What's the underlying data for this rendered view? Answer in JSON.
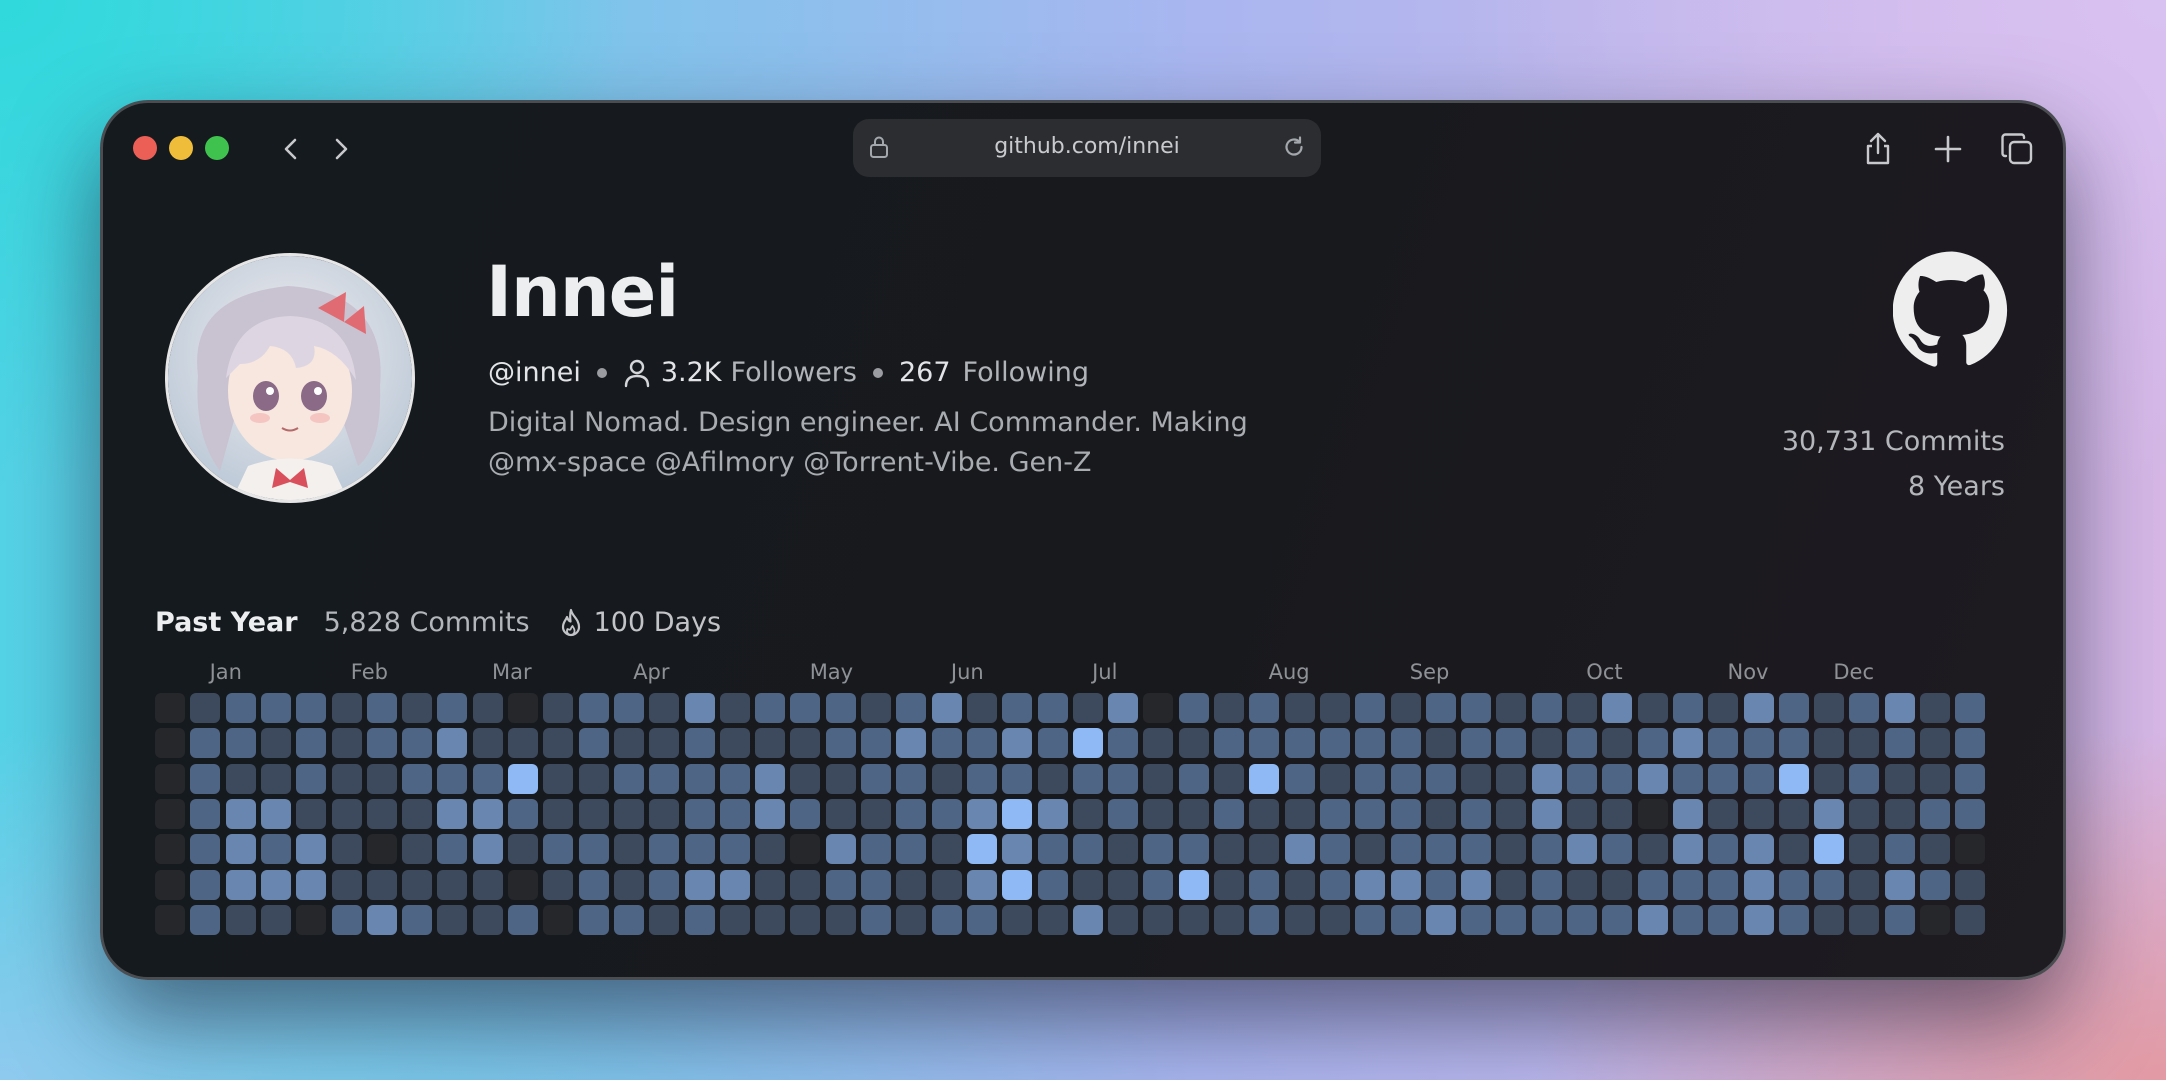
{
  "window": {
    "url": "github.com/innei",
    "traffic_lights": [
      "#ec5f57",
      "#f0bd3a",
      "#3fc34e"
    ],
    "icons": [
      "back-icon",
      "forward-icon",
      "lock-icon",
      "reload-icon",
      "share-icon",
      "plus-icon",
      "tabs-icon"
    ]
  },
  "profile": {
    "name": "Innei",
    "handle": "@innei",
    "followers_count": "3.2K",
    "followers_label": "Followers",
    "following_count": "267",
    "following_label": "Following",
    "bio_line1": "Digital Nomad. Design engineer. AI Commander. Making",
    "bio_line2": "@mx-space @Afilmory @Torrent-Vibe. Gen-Z",
    "total_commits": "30,731 Commits",
    "total_years": "8 Years"
  },
  "activity": {
    "title": "Past Year",
    "commits": "5,828 Commits",
    "streak": "100 Days",
    "months": [
      {
        "label": "Jan",
        "week": 2
      },
      {
        "label": "Feb",
        "week": 6
      },
      {
        "label": "Mar",
        "week": 10
      },
      {
        "label": "Apr",
        "week": 14
      },
      {
        "label": "May",
        "week": 19
      },
      {
        "label": "Jun",
        "week": 23
      },
      {
        "label": "Jul",
        "week": 27
      },
      {
        "label": "Aug",
        "week": 32
      },
      {
        "label": "Sep",
        "week": 36
      },
      {
        "label": "Oct",
        "week": 41
      },
      {
        "label": "Nov",
        "week": 45
      },
      {
        "label": "Dec",
        "week": 48
      }
    ],
    "level_colors": [
      "#25272b",
      "#3d4a5e",
      "#4e6585",
      "#6886b0",
      "#8fb9f4"
    ],
    "weeks": [
      [
        0,
        0,
        0,
        0,
        0,
        0,
        0
      ],
      [
        1,
        2,
        2,
        2,
        2,
        2,
        2
      ],
      [
        2,
        2,
        1,
        3,
        3,
        3,
        1
      ],
      [
        2,
        1,
        1,
        3,
        2,
        3,
        1
      ],
      [
        2,
        2,
        2,
        1,
        3,
        3,
        0
      ],
      [
        1,
        1,
        1,
        1,
        1,
        1,
        2
      ],
      [
        2,
        2,
        1,
        1,
        0,
        1,
        3
      ],
      [
        1,
        2,
        2,
        1,
        1,
        1,
        2
      ],
      [
        2,
        3,
        2,
        3,
        2,
        1,
        1
      ],
      [
        1,
        1,
        2,
        3,
        3,
        1,
        1
      ],
      [
        0,
        1,
        4,
        2,
        1,
        0,
        2
      ],
      [
        1,
        1,
        1,
        1,
        2,
        1,
        0
      ],
      [
        2,
        2,
        1,
        1,
        2,
        2,
        2
      ],
      [
        2,
        1,
        2,
        1,
        1,
        1,
        2
      ],
      [
        1,
        1,
        2,
        1,
        2,
        2,
        1
      ],
      [
        3,
        2,
        2,
        2,
        2,
        3,
        2
      ],
      [
        1,
        1,
        2,
        2,
        2,
        3,
        1
      ],
      [
        2,
        1,
        3,
        3,
        1,
        1,
        1
      ],
      [
        2,
        1,
        1,
        2,
        0,
        1,
        1
      ],
      [
        2,
        2,
        1,
        1,
        3,
        2,
        1
      ],
      [
        1,
        2,
        2,
        1,
        2,
        2,
        2
      ],
      [
        2,
        3,
        2,
        2,
        2,
        1,
        1
      ],
      [
        3,
        2,
        1,
        2,
        1,
        1,
        2
      ],
      [
        1,
        2,
        2,
        3,
        4,
        3,
        2
      ],
      [
        2,
        3,
        2,
        4,
        3,
        4,
        1
      ],
      [
        2,
        2,
        1,
        3,
        2,
        2,
        1
      ],
      [
        1,
        4,
        2,
        1,
        2,
        1,
        3
      ],
      [
        3,
        2,
        2,
        2,
        1,
        1,
        1
      ],
      [
        0,
        1,
        1,
        1,
        2,
        2,
        1
      ],
      [
        2,
        1,
        2,
        1,
        2,
        4,
        1
      ],
      [
        1,
        2,
        1,
        2,
        1,
        1,
        1
      ],
      [
        2,
        2,
        4,
        1,
        1,
        2,
        2
      ],
      [
        1,
        2,
        2,
        1,
        3,
        1,
        1
      ],
      [
        1,
        2,
        1,
        2,
        2,
        2,
        1
      ],
      [
        2,
        2,
        2,
        2,
        1,
        3,
        2
      ],
      [
        1,
        2,
        2,
        2,
        2,
        3,
        2
      ],
      [
        2,
        1,
        2,
        1,
        2,
        2,
        3
      ],
      [
        2,
        2,
        1,
        2,
        2,
        3,
        2
      ],
      [
        1,
        2,
        1,
        1,
        1,
        1,
        2
      ],
      [
        2,
        1,
        3,
        3,
        2,
        2,
        2
      ],
      [
        1,
        2,
        2,
        1,
        3,
        1,
        2
      ],
      [
        3,
        1,
        2,
        1,
        2,
        1,
        2
      ],
      [
        1,
        2,
        3,
        0,
        1,
        2,
        3
      ],
      [
        2,
        3,
        2,
        3,
        3,
        2,
        2
      ],
      [
        1,
        2,
        2,
        1,
        2,
        2,
        2
      ],
      [
        3,
        2,
        2,
        1,
        3,
        3,
        3
      ],
      [
        2,
        2,
        4,
        1,
        1,
        2,
        2
      ],
      [
        1,
        1,
        1,
        3,
        4,
        2,
        1
      ],
      [
        2,
        1,
        2,
        1,
        1,
        1,
        1
      ],
      [
        3,
        2,
        1,
        1,
        2,
        3,
        2
      ],
      [
        1,
        1,
        1,
        2,
        1,
        2,
        0
      ],
      [
        2,
        2,
        2,
        2,
        0,
        1,
        1
      ]
    ]
  }
}
